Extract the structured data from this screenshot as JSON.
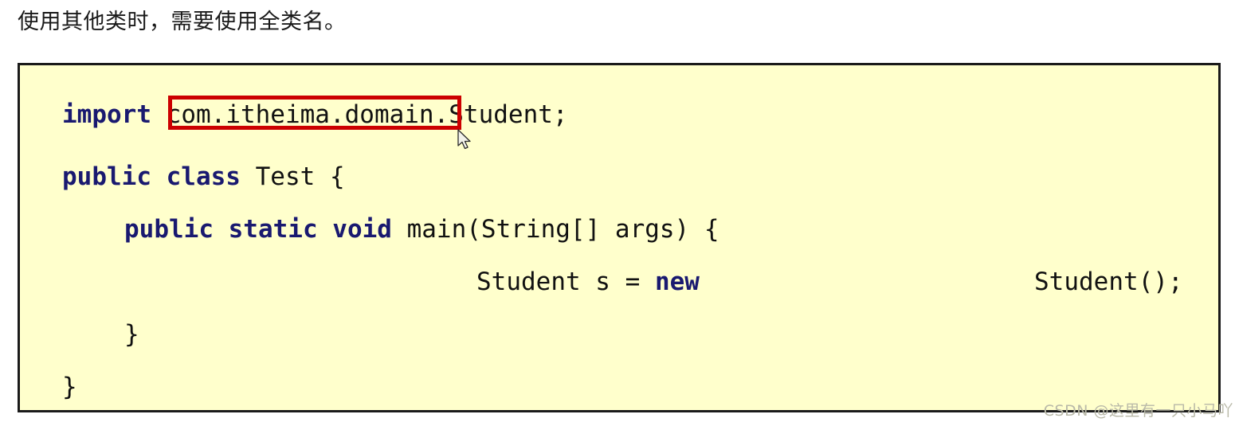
{
  "heading": {
    "text": "使用其他类时，需要使用全类名。"
  },
  "colors": {
    "page_background": "#ffffff",
    "code_background": "#ffffcc",
    "code_border": "#1a1a1a",
    "keyword": "#191970",
    "plain_text": "#111111",
    "highlight_box": "#cc0000",
    "watermark": "#b9b9a8"
  },
  "code_block": {
    "language": "java",
    "lines": [
      {
        "id": "line-import",
        "segments": [
          {
            "text": "import ",
            "kind": "keyword"
          },
          {
            "text": "com.itheima.domain",
            "kind": "plain"
          },
          {
            "text": ".Student;",
            "kind": "plain"
          }
        ],
        "full_text": "import com.itheima.domain.Student;"
      },
      {
        "id": "line-class",
        "segments": [
          {
            "text": "public class ",
            "kind": "keyword"
          },
          {
            "text": "Test {",
            "kind": "plain"
          }
        ],
        "full_text": "public class Test {"
      },
      {
        "id": "line-main",
        "segments": [
          {
            "text": "public static void ",
            "kind": "keyword"
          },
          {
            "text": "main(String[] args) {",
            "kind": "plain"
          }
        ],
        "full_text": "    public static void main(String[] args) {"
      },
      {
        "id": "line-stmt",
        "segments": [
          {
            "text": "Student s = ",
            "kind": "plain"
          },
          {
            "text": "new",
            "kind": "keyword"
          }
        ],
        "full_text": "Student s = new"
      },
      {
        "id": "line-stmt-tail",
        "segments": [
          {
            "text": "Student();",
            "kind": "plain"
          }
        ],
        "full_text": "Student();"
      },
      {
        "id": "line-close-in",
        "segments": [
          {
            "text": "}",
            "kind": "plain"
          }
        ],
        "full_text": "    }"
      },
      {
        "id": "line-close-out",
        "segments": [
          {
            "text": "}",
            "kind": "plain"
          }
        ],
        "full_text": "}"
      }
    ],
    "import_keyword": "import ",
    "import_package": "com.itheima.domain",
    "import_class_suffix": ".Student;",
    "class_keyword": "public class ",
    "class_rest": "Test {",
    "main_keyword": "public static void ",
    "main_rest": "main(String[] args) {",
    "stmt_head": "Student s = ",
    "stmt_new": "new",
    "stmt_tail": "Student();",
    "close_inner": "}",
    "close_outer": "}"
  },
  "annotation": {
    "highlighted_text": "com.itheima.domain",
    "shape": "rectangle-outline"
  },
  "cursor": {
    "icon": "arrow-pointer-icon"
  },
  "watermark": {
    "text": "CSDN @这里有一只小马吖"
  }
}
